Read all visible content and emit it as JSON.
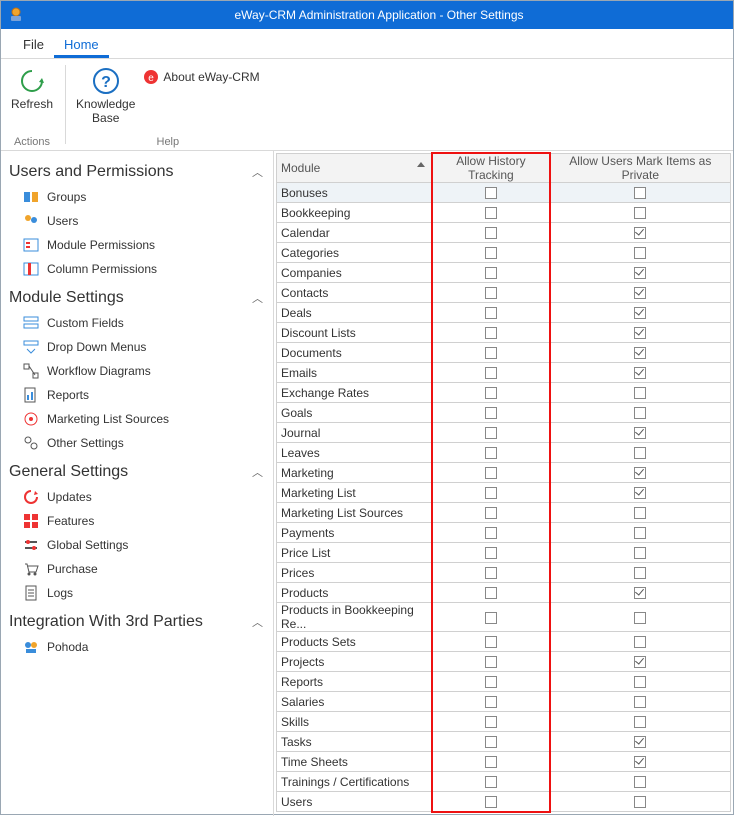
{
  "window": {
    "title": "eWay-CRM Administration Application - Other Settings"
  },
  "menu": {
    "file": "File",
    "home": "Home"
  },
  "ribbon": {
    "refresh": "Refresh",
    "knowledge_base": "Knowledge\nBase",
    "about": "About eWay-CRM",
    "group_actions": "Actions",
    "group_help": "Help"
  },
  "sidebar": {
    "users_permissions": {
      "title": "Users and Permissions",
      "items": [
        "Groups",
        "Users",
        "Module Permissions",
        "Column Permissions"
      ]
    },
    "module_settings": {
      "title": "Module Settings",
      "items": [
        "Custom Fields",
        "Drop Down Menus",
        "Workflow Diagrams",
        "Reports",
        "Marketing List Sources",
        "Other Settings"
      ]
    },
    "general_settings": {
      "title": "General Settings",
      "items": [
        "Updates",
        "Features",
        "Global Settings",
        "Purchase",
        "Logs"
      ]
    },
    "integration": {
      "title": "Integration With 3rd Parties",
      "items": [
        "Pohoda"
      ]
    }
  },
  "grid": {
    "col_module": "Module",
    "col_history": "Allow History Tracking",
    "col_private": "Allow Users Mark Items as Private",
    "rows": [
      {
        "module": "Bonuses",
        "history": false,
        "private": false
      },
      {
        "module": "Bookkeeping",
        "history": false,
        "private": false
      },
      {
        "module": "Calendar",
        "history": false,
        "private": true
      },
      {
        "module": "Categories",
        "history": false,
        "private": false
      },
      {
        "module": "Companies",
        "history": false,
        "private": true
      },
      {
        "module": "Contacts",
        "history": false,
        "private": true
      },
      {
        "module": "Deals",
        "history": false,
        "private": true
      },
      {
        "module": "Discount Lists",
        "history": false,
        "private": true
      },
      {
        "module": "Documents",
        "history": false,
        "private": true
      },
      {
        "module": "Emails",
        "history": false,
        "private": true
      },
      {
        "module": "Exchange Rates",
        "history": false,
        "private": false
      },
      {
        "module": "Goals",
        "history": false,
        "private": false
      },
      {
        "module": "Journal",
        "history": false,
        "private": true
      },
      {
        "module": "Leaves",
        "history": false,
        "private": false
      },
      {
        "module": "Marketing",
        "history": false,
        "private": true
      },
      {
        "module": "Marketing List",
        "history": false,
        "private": true
      },
      {
        "module": "Marketing List Sources",
        "history": false,
        "private": false
      },
      {
        "module": "Payments",
        "history": false,
        "private": false
      },
      {
        "module": "Price List",
        "history": false,
        "private": false
      },
      {
        "module": "Prices",
        "history": false,
        "private": false
      },
      {
        "module": "Products",
        "history": false,
        "private": true
      },
      {
        "module": "Products in Bookkeeping Re...",
        "history": false,
        "private": false
      },
      {
        "module": "Products Sets",
        "history": false,
        "private": false
      },
      {
        "module": "Projects",
        "history": false,
        "private": true
      },
      {
        "module": "Reports",
        "history": false,
        "private": false
      },
      {
        "module": "Salaries",
        "history": false,
        "private": false
      },
      {
        "module": "Skills",
        "history": false,
        "private": false
      },
      {
        "module": "Tasks",
        "history": false,
        "private": true
      },
      {
        "module": "Time Sheets",
        "history": false,
        "private": true
      },
      {
        "module": "Trainings / Certifications",
        "history": false,
        "private": false
      },
      {
        "module": "Users",
        "history": false,
        "private": false
      }
    ]
  }
}
